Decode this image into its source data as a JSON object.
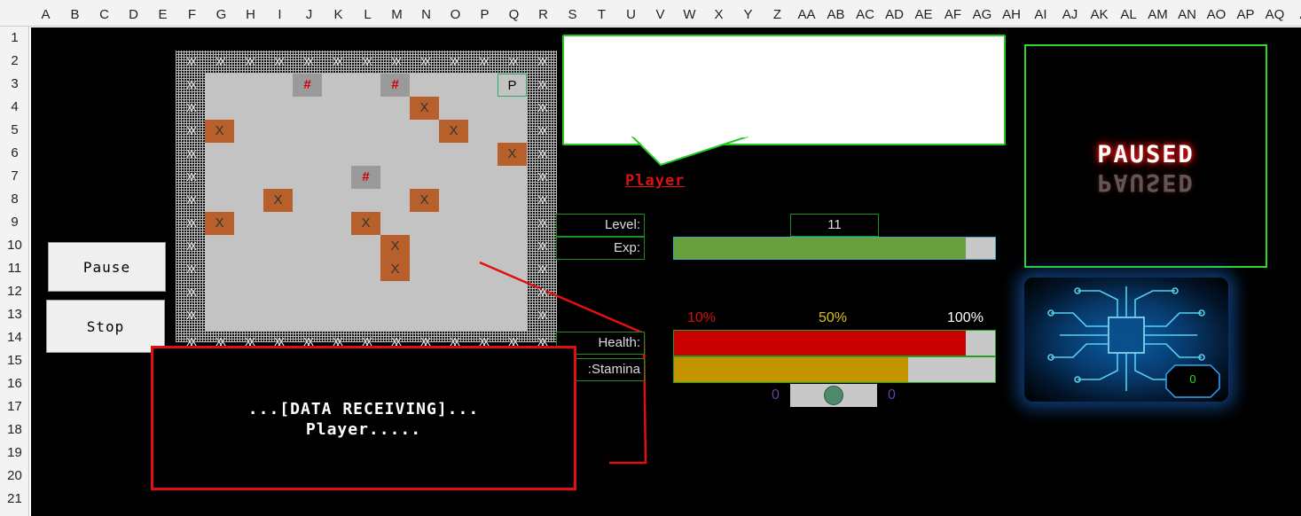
{
  "columns": [
    "A",
    "B",
    "C",
    "D",
    "E",
    "F",
    "G",
    "H",
    "I",
    "J",
    "K",
    "L",
    "M",
    "N",
    "O",
    "P",
    "Q",
    "R",
    "S",
    "T",
    "U",
    "V",
    "W",
    "X",
    "Y",
    "Z",
    "AA",
    "AB",
    "AC",
    "AD",
    "AE",
    "AF",
    "AG",
    "AH",
    "AI",
    "AJ",
    "AK",
    "AL",
    "AM",
    "AN",
    "AO",
    "AP",
    "AQ",
    "A"
  ],
  "rows": [
    "1",
    "2",
    "3",
    "4",
    "5",
    "6",
    "7",
    "8",
    "9",
    "10",
    "11",
    "12",
    "13",
    "14",
    "15",
    "16",
    "17",
    "18",
    "19",
    "20",
    "21"
  ],
  "board": {
    "wall_glyph": "X",
    "block_glyph": "X",
    "hash_glyph": "#",
    "player_glyph": "P"
  },
  "buttons": {
    "pause": "Pause",
    "stop": "Stop"
  },
  "speech": {
    "player_name": "Player"
  },
  "stats": {
    "level_label": "Level:",
    "level_value": "11",
    "exp_label": "Exp:",
    "exp_fraction": 0.91,
    "health_label": "Health:",
    "health_fraction": 0.91,
    "stamina_label": "Stamina:",
    "stamina_fraction": 0.73,
    "tick_10": "10%",
    "tick_50": "50%",
    "tick_100": "100%",
    "slider_left": "0",
    "slider_right": "0"
  },
  "status_panel": {
    "paused_text": "PAUSED"
  },
  "chip_panel": {
    "counter": "0"
  },
  "console": {
    "line1": "...[DATA RECEIVING]...",
    "line2": "Player....."
  },
  "colors": {
    "background": "#000000",
    "board_floor": "#c3c3c3",
    "block": "#b8602b",
    "hash": "#cc0000",
    "green_border": "#22cc22",
    "exp_bar": "#6a9f3e",
    "health_bar": "#c80000",
    "stamina_bar": "#c49400",
    "console_border": "#e01010",
    "tick_10_color": "#cc1111",
    "tick_50_color": "#d6c21a",
    "tick_100_color": "#ffffff"
  }
}
